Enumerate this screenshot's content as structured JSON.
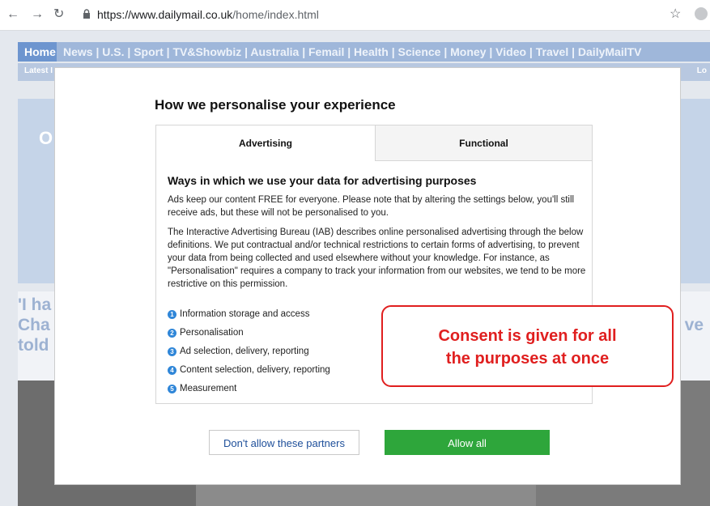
{
  "browser": {
    "url_host": "https://www.dailymail.co.uk",
    "url_path": "/home/index.html",
    "icons": [
      "back-arrow-icon",
      "forward-arrow-icon",
      "reload-icon",
      "lock-icon",
      "star-icon",
      "profile-icon"
    ]
  },
  "site": {
    "nav_home": "Home",
    "nav_links": "News | U.S. | Sport | TV&Showbiz | Australia | Femail | Health | Science | Money | Video | Travel | DailyMailTV",
    "sub_left": "Latest I",
    "sub_right": "Lo",
    "hero_letter": "O",
    "headline_left": "'I ha\nCha\ntold",
    "headline_right": "ve"
  },
  "modal": {
    "title": "How we personalise your experience",
    "tabs": [
      {
        "label": "Advertising",
        "active": true
      },
      {
        "label": "Functional",
        "active": false
      }
    ],
    "heading": "Ways in which we use your data for advertising purposes",
    "paragraph1": "Ads keep our content FREE for everyone. Please note that by altering the settings below, you'll still receive ads, but these will not be personalised to you.",
    "paragraph2": "The Interactive Advertising Bureau (IAB) describes online personalised advertising through the below definitions. We put contractual and/or technical restrictions to certain forms of advertising, to prevent your data from being collected and used elsewhere without your knowledge. For instance, as \"Personalisation\" requires a company to track your information from our websites, we tend to be more restrictive on this permission.",
    "purposes": [
      {
        "num": "1",
        "label": "Information storage and access"
      },
      {
        "num": "2",
        "label": "Personalisation"
      },
      {
        "num": "3",
        "label": "Ad selection, delivery, reporting"
      },
      {
        "num": "4",
        "label": "Content selection, delivery, reporting"
      },
      {
        "num": "5",
        "label": "Measurement"
      }
    ],
    "deny_button": "Don't allow these partners",
    "allow_button": "Allow all"
  },
  "annotation": {
    "line1": "Consent is given for all",
    "line2": "the purposes at once",
    "color": "#e01f1f"
  },
  "colors": {
    "allow_green": "#2ea63b",
    "deny_text_blue": "#1e4f9a",
    "purpose_badge_blue": "#2f86d8"
  }
}
